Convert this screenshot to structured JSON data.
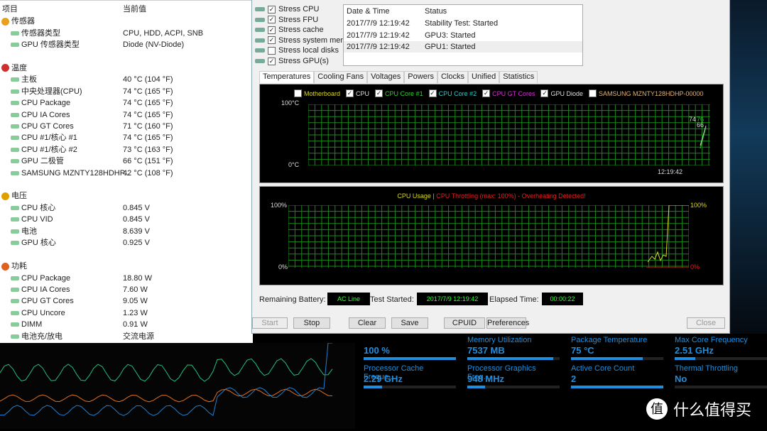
{
  "sensors": {
    "header": {
      "item": "项目",
      "value": "当前值"
    },
    "groups": [
      {
        "title": "传感器",
        "rows": [
          [
            "传感器类型",
            "CPU, HDD, ACPI, SNB"
          ],
          [
            "GPU 传感器类型",
            "Diode  (NV-Diode)"
          ]
        ]
      },
      {
        "title": "温度",
        "rows": [
          [
            "主板",
            "40 °C  (104 °F)"
          ],
          [
            "中央处理器(CPU)",
            "74 °C  (165 °F)"
          ],
          [
            "CPU Package",
            "74 °C  (165 °F)"
          ],
          [
            "CPU IA Cores",
            "74 °C  (165 °F)"
          ],
          [
            "CPU GT Cores",
            "71 °C  (160 °F)"
          ],
          [
            "CPU #1/核心 #1",
            "74 °C  (165 °F)"
          ],
          [
            "CPU #1/核心 #2",
            "73 °C  (163 °F)"
          ],
          [
            "GPU 二极管",
            "66 °C  (151 °F)"
          ],
          [
            "SAMSUNG MZNTY128HDHP...",
            "42 °C  (108 °F)"
          ]
        ]
      },
      {
        "title": "电压",
        "rows": [
          [
            "CPU 核心",
            "0.845 V"
          ],
          [
            "CPU VID",
            "0.845 V"
          ],
          [
            "电池",
            "8.639 V"
          ],
          [
            "GPU 核心",
            "0.925 V"
          ]
        ]
      },
      {
        "title": "功耗",
        "rows": [
          [
            "CPU Package",
            "18.80 W"
          ],
          [
            "CPU IA Cores",
            "7.60 W"
          ],
          [
            "CPU GT Cores",
            "9.05 W"
          ],
          [
            "CPU Uncore",
            "1.23 W"
          ],
          [
            "DIMM",
            "0.91 W"
          ],
          [
            "电池充/放电",
            "交流电源"
          ]
        ]
      }
    ]
  },
  "stress": [
    {
      "label": "Stress CPU",
      "checked": true
    },
    {
      "label": "Stress FPU",
      "checked": true
    },
    {
      "label": "Stress cache",
      "checked": true
    },
    {
      "label": "Stress system memo",
      "checked": true
    },
    {
      "label": "Stress local disks",
      "checked": false
    },
    {
      "label": "Stress GPU(s)",
      "checked": true
    }
  ],
  "log": {
    "headers": [
      "Date & Time",
      "Status"
    ],
    "rows": [
      [
        "2017/7/9 12:19:42",
        "Stability Test: Started"
      ],
      [
        "2017/7/9 12:19:42",
        "GPU3: Started"
      ],
      [
        "2017/7/9 12:19:42",
        "GPU1: Started"
      ]
    ]
  },
  "tabs": [
    "Temperatures",
    "Cooling Fans",
    "Voltages",
    "Powers",
    "Clocks",
    "Unified",
    "Statistics"
  ],
  "temp_graph": {
    "legend": [
      {
        "label": "Motherboard",
        "checked": false,
        "color": "#d8d820"
      },
      {
        "label": "CPU",
        "checked": true,
        "color": "#dddddd"
      },
      {
        "label": "CPU Core #1",
        "checked": true,
        "color": "#30d030"
      },
      {
        "label": "CPU Core #2",
        "checked": true,
        "color": "#30c8c8"
      },
      {
        "label": "CPU GT Cores",
        "checked": true,
        "color": "#d030d0"
      },
      {
        "label": "GPU Diode",
        "checked": true,
        "color": "#dddddd"
      },
      {
        "label": "SAMSUNG MZNTY128HDHP-00000",
        "checked": false,
        "color": "#e0b070"
      }
    ],
    "ymax": "100°C",
    "ymin": "0°C",
    "time": "12:19:42",
    "readouts": [
      "74",
      "76",
      "66"
    ]
  },
  "usage_graph": {
    "title_a": "CPU Usage",
    "sep": "|",
    "title_b": "CPU Throttling (max: 100%) - Overheating Detected!",
    "ymax": "100%",
    "ymin": "0%",
    "right_top": "100%",
    "right_bottom": "0%"
  },
  "status": {
    "battery_label": "Remaining Battery:",
    "battery": "AC Line",
    "started_label": "Test Started:",
    "started": "2017/7/9 12:19:42",
    "elapsed_label": "Elapsed Time:",
    "elapsed": "00:00:22"
  },
  "buttons": {
    "start": "Start",
    "stop": "Stop",
    "clear": "Clear",
    "save": "Save",
    "cpuid": "CPUID",
    "prefs": "Preferences",
    "close": "Close"
  },
  "tiles": [
    {
      "title": "",
      "value": "100 %",
      "fill": 1.0
    },
    {
      "title": "Memory Utilization",
      "value": "7537  MB",
      "fill": 0.93
    },
    {
      "title": "Package Temperature",
      "value": "75 °C",
      "fill": 0.78
    },
    {
      "title": "Max Core Frequency",
      "value": "2.51 GHz",
      "fill": 0.22
    },
    {
      "title": "Processor Cache Freque...",
      "value": "2.29 GHz",
      "fill": 0.2
    },
    {
      "title": "Processor Graphics Freq...",
      "value": "948 MHz",
      "fill": 0.19
    },
    {
      "title": "Active Core Count",
      "value": "2",
      "fill": 1.0
    },
    {
      "title": "Thermal Throttling",
      "value": "No",
      "fill": 0
    }
  ],
  "watermark": "什么值得买",
  "colors": {
    "accent": "#1e8fe0",
    "grid": "#1a8a1a"
  }
}
